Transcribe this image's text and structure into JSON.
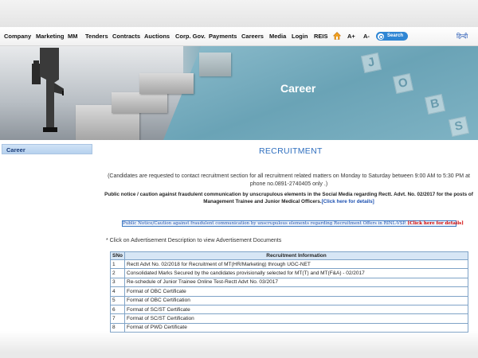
{
  "nav": {
    "items": [
      "Company",
      "Marketing",
      "MM",
      "Tenders",
      "Contracts",
      "Auctions",
      "Corp. Gov.",
      "Payments",
      "Careers",
      "Media",
      "Login",
      "REIS"
    ],
    "font_increase": "A+",
    "font_decrease": "A-",
    "search_label": "Search",
    "hindi": "हिन्दी"
  },
  "banner": {
    "title": "Career",
    "jobs_letters": [
      "J",
      "O",
      "B",
      "S"
    ]
  },
  "sidebar": {
    "items": [
      {
        "label": "Career"
      }
    ]
  },
  "main": {
    "title": "RECRUITMENT",
    "contact_note": "(Candidates are requested to contact recruitment section for all recruitment related matters on Monday to Saturday between 9:00 AM to 5:30 PM at phone no.0891-2740405 only .)",
    "public_notice": "Public notice / caution against fraudulent communication by unscrupulous elements in the Social Media regarding Rectt. Advt. No. 02/2017 for the posts of Management Trainee and Junior Medical Officers.",
    "public_notice_link": "[Click here for details]",
    "caution_text": "Public Notice/Caution against fraudulent communication by unscrupulous elements regarding Recruitment Offers in RINL-VSP.",
    "caution_link": "[Click here for details]",
    "instruction": "* Click on Advertisement Description to view Advertisement Documents"
  },
  "table": {
    "headers": [
      "SNo",
      "Recruitment Information"
    ],
    "rows": [
      {
        "sno": "1",
        "info": "Rectt Advt No. 02/2018 for Recruitment of MT(HR/Marketing) through UGC-NET"
      },
      {
        "sno": "2",
        "info": "Consolidated Marks Secured by the candidates provisionally selected for MT(T) and MT(F&A) - 02/2017"
      },
      {
        "sno": "3",
        "info": "Re-schedule of Junior Trainee Online Test-Rectt Advt No. 03/2017"
      },
      {
        "sno": "4",
        "info": "Format of OBC Certificate"
      },
      {
        "sno": "5",
        "info": "Format of OBC Certification"
      },
      {
        "sno": "6",
        "info": "Format of SC/ST Certificate"
      },
      {
        "sno": "7",
        "info": "Format of SC/ST Certification"
      },
      {
        "sno": "8",
        "info": "Format of PWD Certificate"
      }
    ]
  },
  "colors": {
    "accent": "#2f6fbf",
    "search": "#2f86d4",
    "table_border": "#7fa3c7",
    "table_header_bg": "#d7e6f5",
    "caution_red": "#d10000"
  },
  "icons": {
    "home": "home-icon",
    "search": "search-icon"
  }
}
